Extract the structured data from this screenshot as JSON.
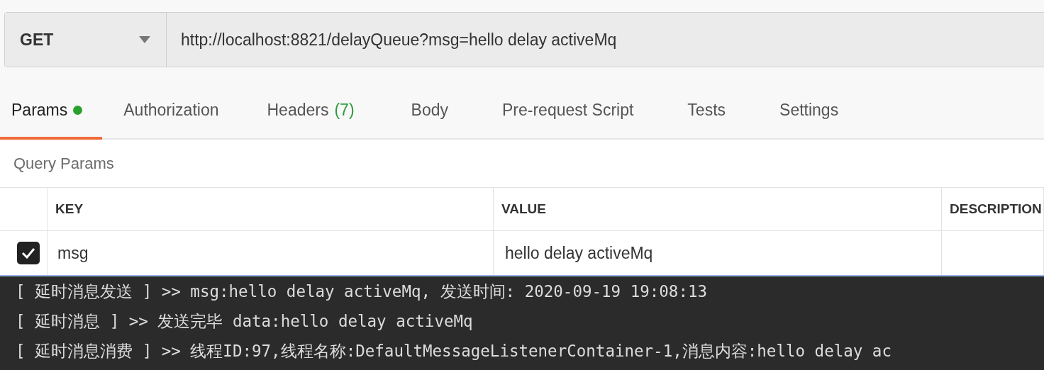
{
  "request": {
    "method": "GET",
    "url": "http://localhost:8821/delayQueue?msg=hello delay activeMq"
  },
  "tabs": [
    {
      "label": "Params",
      "selected": true,
      "dot": true
    },
    {
      "label": "Authorization",
      "selected": false,
      "dot": false
    },
    {
      "label": "Headers",
      "count": "(7)",
      "selected": false,
      "dot": false
    },
    {
      "label": "Body",
      "selected": false,
      "dot": false
    },
    {
      "label": "Pre-request Script",
      "selected": false,
      "dot": false
    },
    {
      "label": "Tests",
      "selected": false,
      "dot": false
    },
    {
      "label": "Settings",
      "selected": false,
      "dot": false
    }
  ],
  "section_title": "Query Params",
  "table": {
    "columns": [
      "KEY",
      "VALUE",
      "DESCRIPTION"
    ],
    "rows": [
      {
        "checked": true,
        "key": "msg",
        "value": "hello delay activeMq"
      }
    ]
  },
  "console": [
    "[ 延时消息发送 ] >> msg:hello delay activeMq, 发送时间: 2020-09-19 19:08:13",
    "[ 延时消息 ] >> 发送完毕 data:hello delay activeMq",
    "[ 延时消息消费 ] >> 线程ID:97,线程名称:DefaultMessageListenerContainer-1,消息内容:hello delay ac"
  ]
}
